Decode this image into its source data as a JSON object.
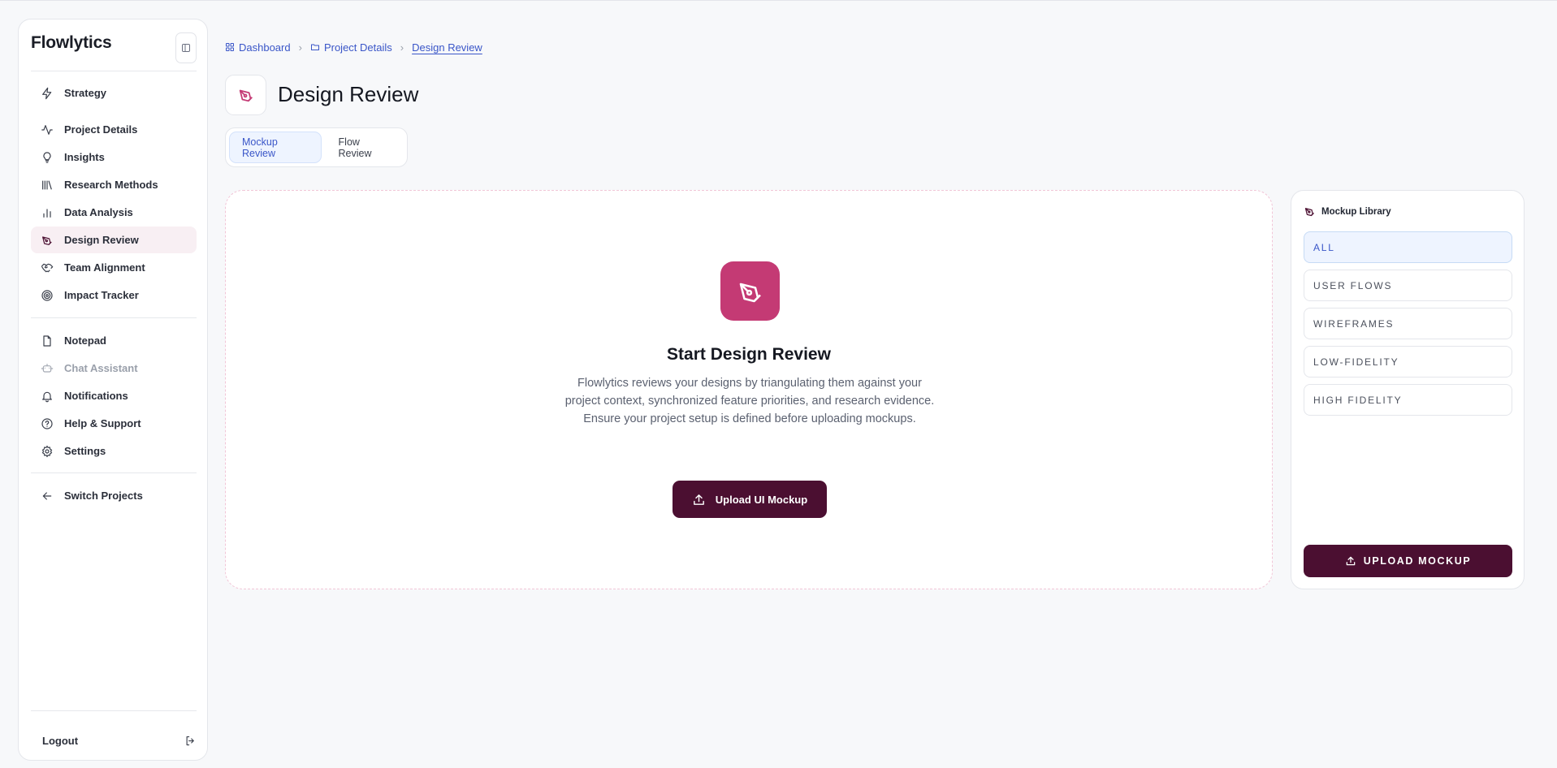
{
  "app": {
    "name": "Flowlytics"
  },
  "sidebar": {
    "primary": [
      {
        "label": "Strategy",
        "icon": "bolt-icon"
      },
      {
        "label": "Project Details",
        "icon": "activity-icon"
      },
      {
        "label": "Insights",
        "icon": "lightbulb-icon"
      },
      {
        "label": "Research Methods",
        "icon": "library-icon"
      },
      {
        "label": "Data Analysis",
        "icon": "bar-chart-icon"
      },
      {
        "label": "Design Review",
        "icon": "pen-tool-icon",
        "active": true
      },
      {
        "label": "Team Alignment",
        "icon": "handshake-icon"
      },
      {
        "label": "Impact Tracker",
        "icon": "target-icon"
      }
    ],
    "secondary": [
      {
        "label": "Notepad",
        "icon": "file-icon"
      },
      {
        "label": "Chat Assistant",
        "icon": "bot-icon",
        "disabled": true
      },
      {
        "label": "Notifications",
        "icon": "bell-icon"
      },
      {
        "label": "Help & Support",
        "icon": "help-circle-icon"
      },
      {
        "label": "Settings",
        "icon": "gear-icon"
      }
    ],
    "switch_projects": "Switch Projects",
    "logout": "Logout"
  },
  "breadcrumb": [
    {
      "label": "Dashboard",
      "icon": "grid-icon"
    },
    {
      "label": "Project Details",
      "icon": "folder-icon"
    },
    {
      "label": "Design Review",
      "current": true
    }
  ],
  "header": {
    "title": "Design Review"
  },
  "tabs": [
    {
      "label": "Mockup Review",
      "active": true
    },
    {
      "label": "Flow Review"
    }
  ],
  "main": {
    "title": "Start Design Review",
    "description": "Flowlytics reviews your designs by triangulating them against your project context, synchronized feature priorities, and research evidence. Ensure your project setup is defined before uploading mockups.",
    "upload_label": "Upload UI Mockup"
  },
  "library": {
    "title": "Mockup Library",
    "filters": [
      {
        "label": "ALL",
        "active": true
      },
      {
        "label": "USER FLOWS"
      },
      {
        "label": "WIREFRAMES"
      },
      {
        "label": "LOW-FIDELITY"
      },
      {
        "label": "HIGH FIDELITY"
      }
    ],
    "upload_label": "UPLOAD MOCKUP"
  },
  "colors": {
    "accent": "#c43a74",
    "primary_dark": "#4b0f31",
    "link_blue": "#3a56c8",
    "active_nav_bg": "#f8eff3",
    "active_tab_bg": "#eef4ff"
  }
}
